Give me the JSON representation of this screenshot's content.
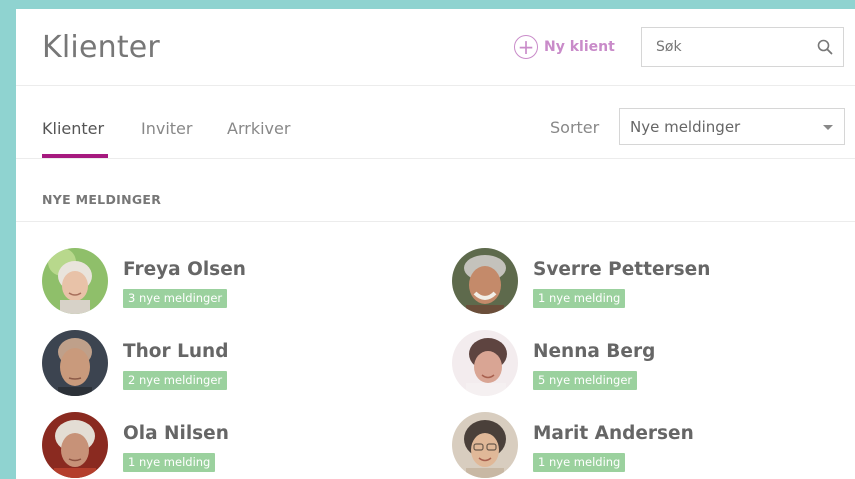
{
  "header": {
    "title": "Klienter",
    "new_client_label": "Ny klient",
    "search_placeholder": "Søk"
  },
  "tabs": [
    {
      "label": "Klienter",
      "active": true
    },
    {
      "label": "Inviter",
      "active": false
    },
    {
      "label": "Arrkiver",
      "active": false
    }
  ],
  "sort": {
    "label": "Sorter",
    "selected": "Nye meldinger"
  },
  "section": {
    "title": "NYE MELDINGER"
  },
  "clients": [
    {
      "name": "Freya Olsen",
      "badge": "3 nye meldinger"
    },
    {
      "name": "Sverre Pettersen",
      "badge": "1 nye melding"
    },
    {
      "name": "Thor Lund",
      "badge": "2 nye meldinger"
    },
    {
      "name": "Nenna Berg",
      "badge": "5 nye meldinger"
    },
    {
      "name": "Ola Nilsen",
      "badge": "1 nye melding"
    },
    {
      "name": "Marit Andersen",
      "badge": "1 nye melding"
    }
  ],
  "colors": {
    "accent": "#a6197f",
    "new_client": "#c98bc9",
    "badge": "#9bd19e",
    "background": "#8fd3d0"
  }
}
